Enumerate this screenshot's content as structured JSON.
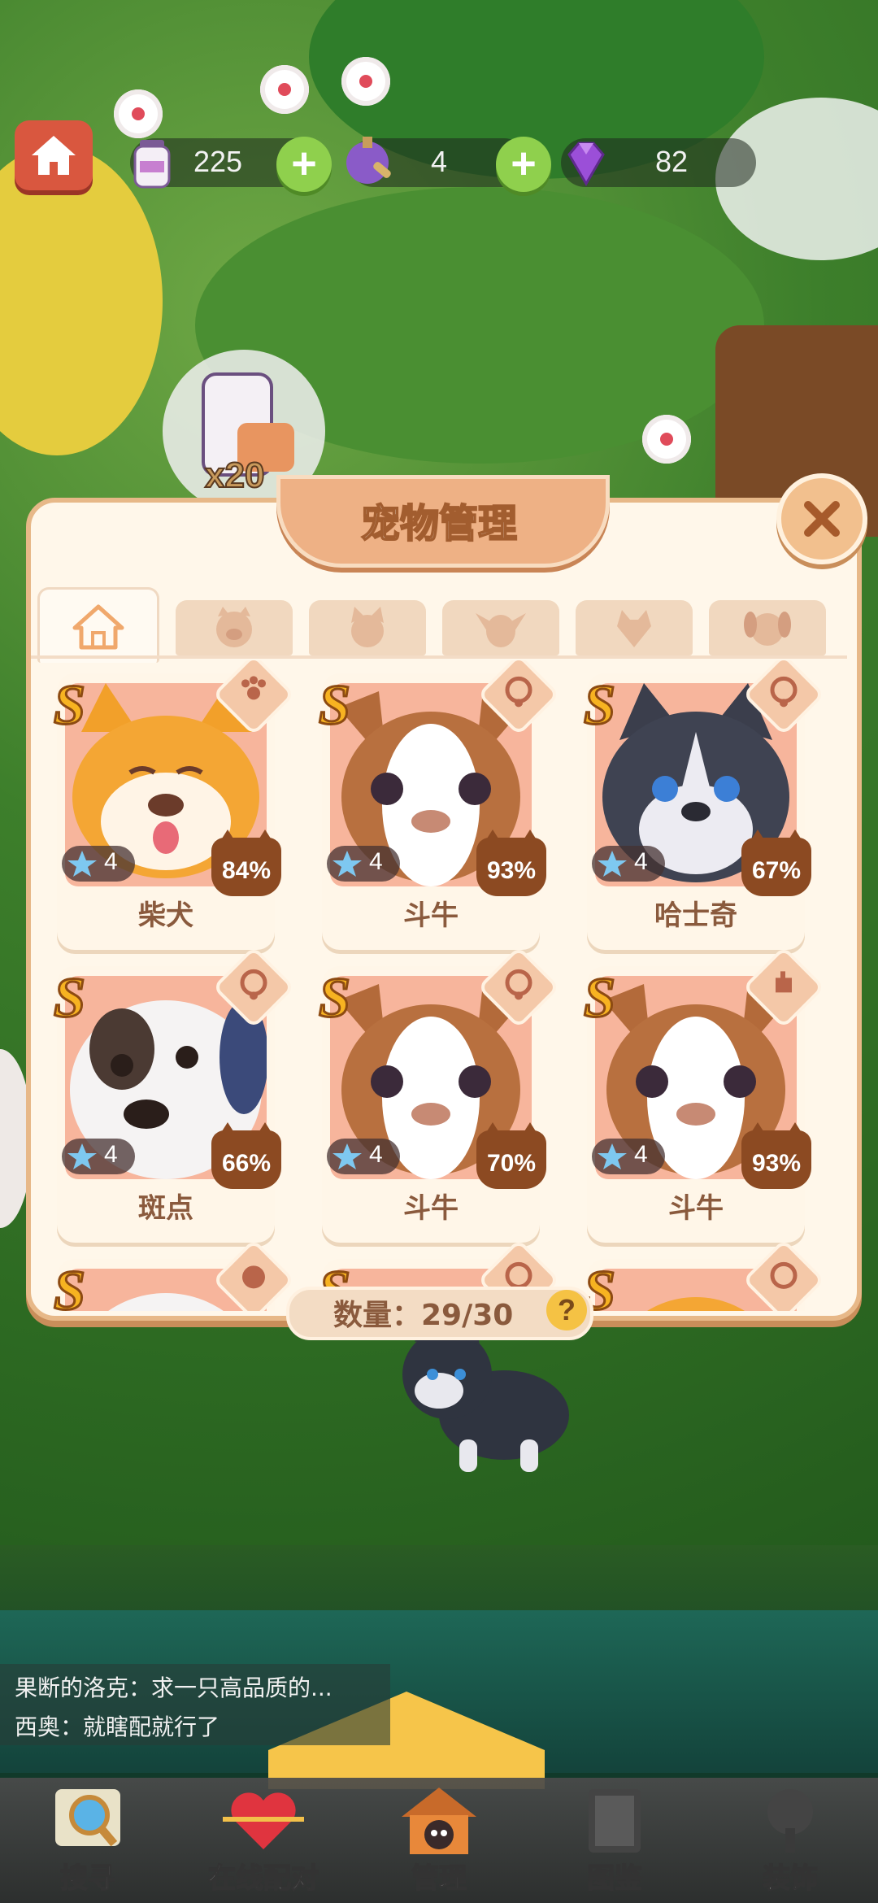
{
  "resources": {
    "milk": "225",
    "potion": "4",
    "gem": "82"
  },
  "reward_bubble": {
    "multiplier": "x20"
  },
  "panel": {
    "title": "宠物管理",
    "count_label": "数量：29/30",
    "help": "?"
  },
  "tabs": [
    {
      "icon": "home-icon",
      "active": true
    },
    {
      "icon": "pig-face-icon",
      "active": false
    },
    {
      "icon": "cat-face-icon",
      "active": false
    },
    {
      "icon": "chihuahua-face-icon",
      "active": false
    },
    {
      "icon": "fox-face-icon",
      "active": false
    },
    {
      "icon": "dog-face-icon",
      "active": false
    }
  ],
  "pets": [
    {
      "rank": "S",
      "stars": "4",
      "affinity": "84%",
      "name": "柴犬",
      "type_icon": "paw-burst-icon"
    },
    {
      "rank": "S",
      "stars": "4",
      "affinity": "93%",
      "name": "斗牛",
      "type_icon": "collar-icon"
    },
    {
      "rank": "S",
      "stars": "4",
      "affinity": "67%",
      "name": "哈士奇",
      "type_icon": "collar-icon"
    },
    {
      "rank": "S",
      "stars": "4",
      "affinity": "66%",
      "name": "斑点",
      "type_icon": "collar-icon"
    },
    {
      "rank": "S",
      "stars": "4",
      "affinity": "70%",
      "name": "斗牛",
      "type_icon": "collar-icon"
    },
    {
      "rank": "S",
      "stars": "4",
      "affinity": "93%",
      "name": "斗牛",
      "type_icon": "hand-heart-icon"
    },
    {
      "rank": "S",
      "type_icon": "cat-mood-icon"
    },
    {
      "rank": "S",
      "type_icon": "collar-icon"
    },
    {
      "rank": "S",
      "type_icon": "collar-icon"
    }
  ],
  "chat": [
    "果断的洛克：求一只高品质的...",
    "西奥：就瞎配就行了"
  ],
  "nav": [
    {
      "label": "搜寻",
      "icon": "magnifier-icon"
    },
    {
      "label": "在线配对",
      "icon": "heart-arrow-icon"
    },
    {
      "label": "管理",
      "icon": "pet-house-icon"
    },
    {
      "label": "图鉴",
      "icon": "book-icon"
    },
    {
      "label": "装饰",
      "icon": "tree-icon"
    }
  ],
  "colors": {
    "panel_bg": "#fff7ea",
    "panel_border": "#e7b888",
    "card_art_bg": "#f7b59c",
    "affinity_badge": "#8c4a22",
    "rank_gold": "#f7b321",
    "plus_green": "#8fd04d",
    "home_red": "#d9573f"
  }
}
